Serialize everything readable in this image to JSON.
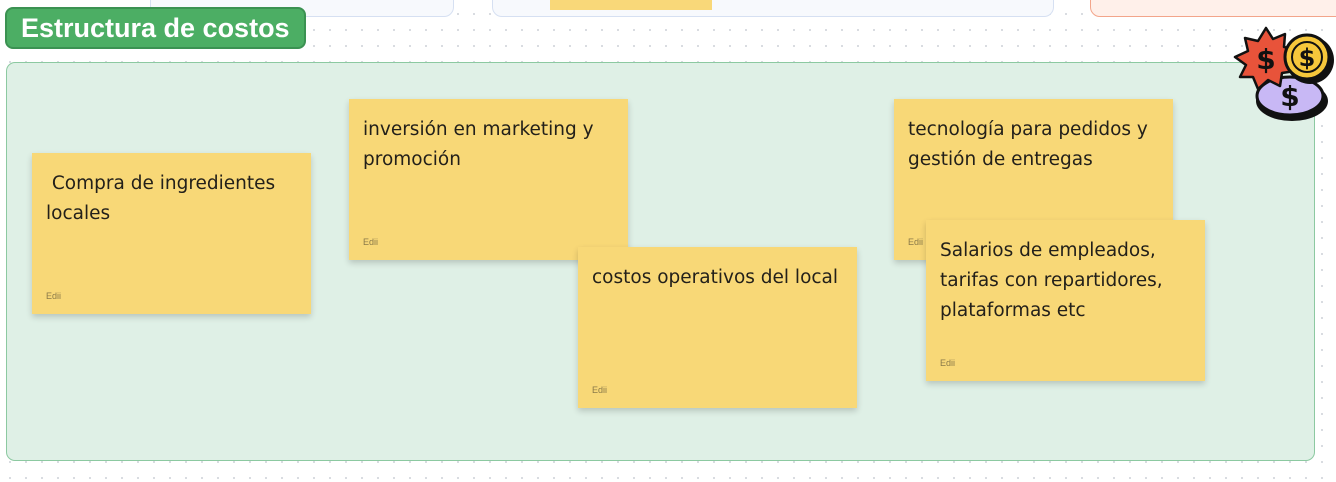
{
  "section": {
    "title": "Estructura de costos"
  },
  "notes": [
    {
      "text": " Compra de ingredientes locales",
      "author": "Edii"
    },
    {
      "text": "inversión en marketing y promoción",
      "author": "Edii"
    },
    {
      "text": "costos operativos del local",
      "author": "Edii"
    },
    {
      "text": "tecnología para pedidos y gestión de entregas",
      "author": "Edii"
    },
    {
      "text": "Salarios de empleados, tarifas con repartidores, plataformas etc",
      "author": "Edii"
    }
  ],
  "sticker": {
    "icon": "dollar-coins-icon",
    "symbol": "$"
  },
  "colors": {
    "frame_bg": "#dff0e6",
    "title_bg": "#4cae64",
    "sticky_bg": "#f8d877",
    "coin_red": "#e8533a",
    "coin_yellow": "#f6c73b",
    "coin_purple": "#c8b8f5"
  }
}
